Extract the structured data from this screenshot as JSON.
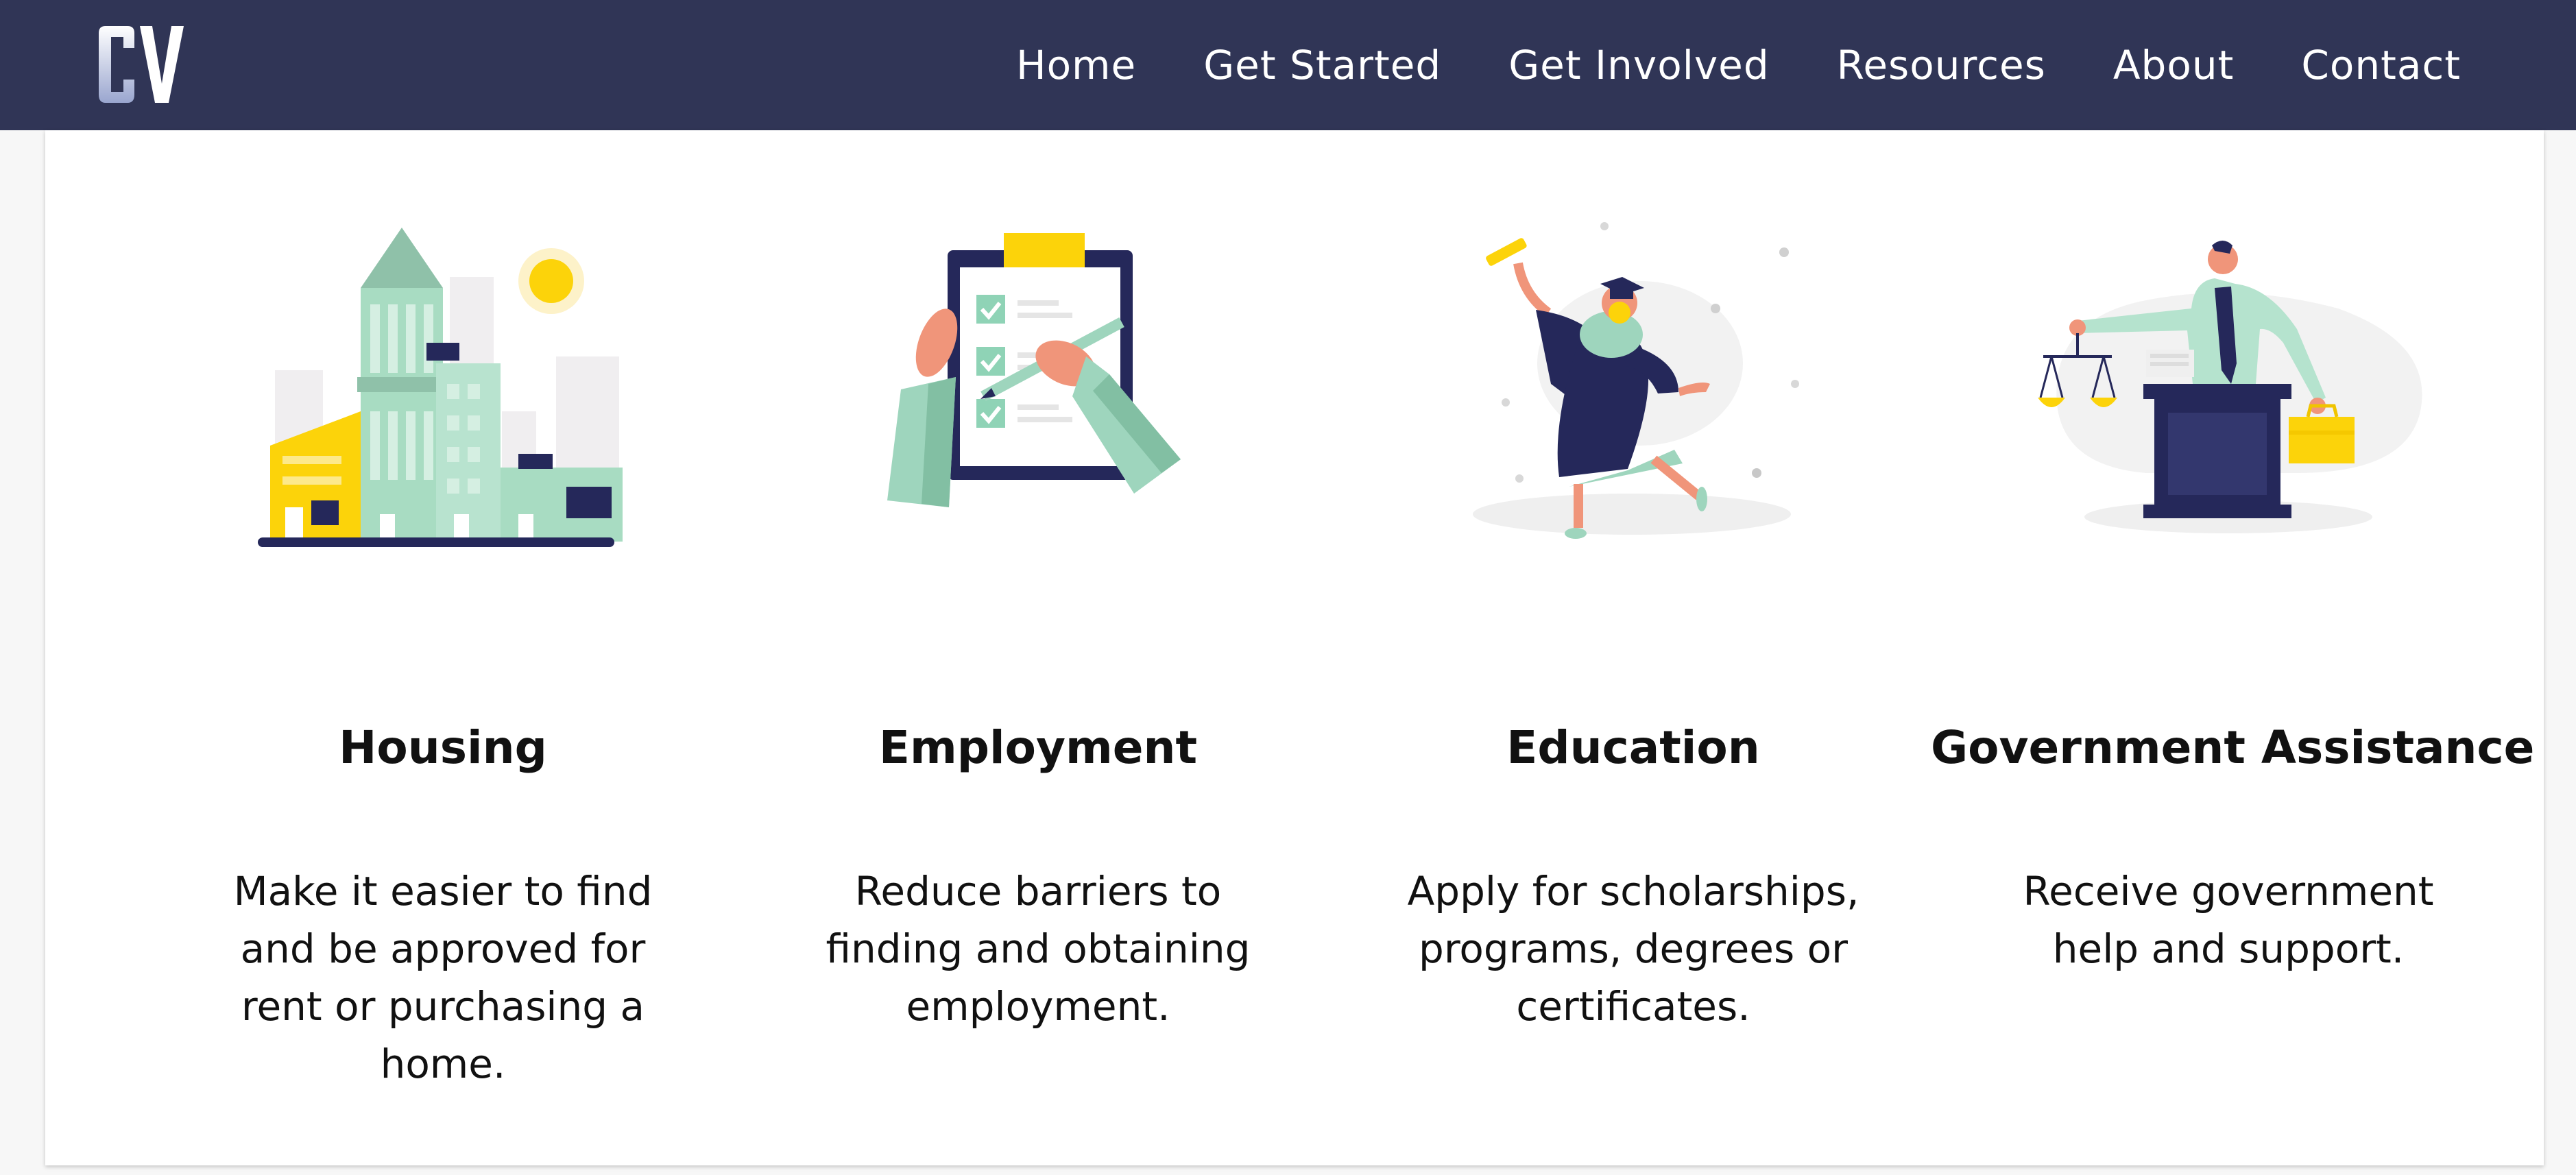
{
  "header": {
    "logo_text": "CV",
    "nav": [
      "Home",
      "Get Started",
      "Get Involved",
      "Resources",
      "About",
      "Contact"
    ]
  },
  "colors": {
    "navbar": "#303556",
    "accent_green": "#9ed5bd",
    "accent_yellow": "#fcd30a",
    "accent_navy": "#25285a"
  },
  "cards": [
    {
      "icon": "city-buildings-icon",
      "title": "Housing",
      "description": "Make it easier to find and be approved for rent or purchasing a home."
    },
    {
      "icon": "clipboard-checklist-icon",
      "title": "Employment",
      "description": "Reduce barriers to finding and obtaining employment."
    },
    {
      "icon": "graduate-icon",
      "title": "Education",
      "description": "Apply for scholarships, programs, degrees or certificates."
    },
    {
      "icon": "government-podium-icon",
      "title": "Government Assistance",
      "description": "Receive government help and support."
    }
  ]
}
